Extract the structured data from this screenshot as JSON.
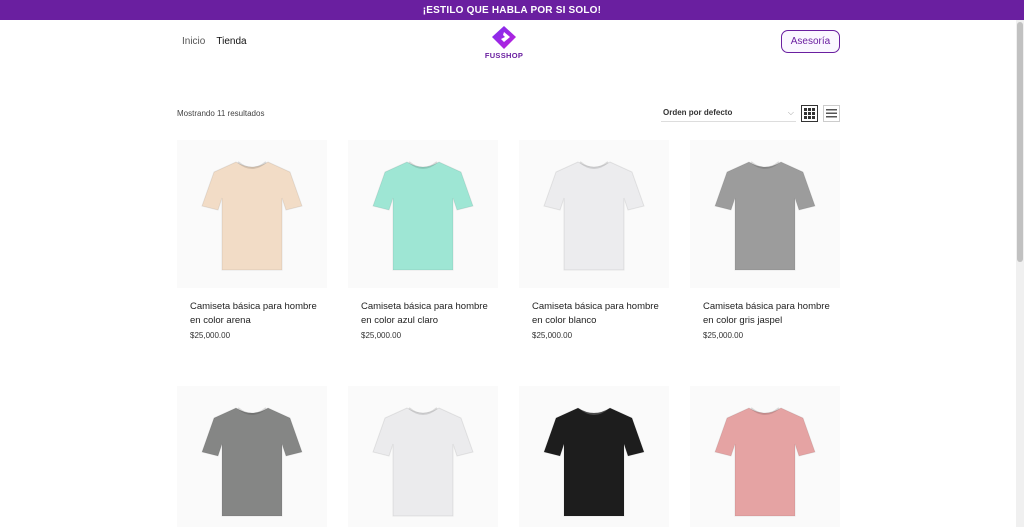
{
  "announcement": "¡ESTILO QUE HABLA POR SI SOLO!",
  "nav": {
    "inicio": "Inicio",
    "tienda": "Tienda"
  },
  "logo": {
    "text": "FUSSHOP"
  },
  "asesoria": "Asesoría",
  "shop": {
    "result_count": "Mostrando 11 resultados",
    "orderby": {
      "selected": "Orden por defecto"
    },
    "view_modes": [
      "grid",
      "list"
    ]
  },
  "colors": {
    "brand": "#6a1fa0"
  },
  "products": [
    {
      "title": "Camiseta básica para hombre en color arena",
      "price": "$25,000.00",
      "shirt_color": "#f2dcc6"
    },
    {
      "title": "Camiseta básica para hombre en color azul claro",
      "price": "$25,000.00",
      "shirt_color": "#9ee6d4"
    },
    {
      "title": "Camiseta básica para hombre en color blanco",
      "price": "$25,000.00",
      "shirt_color": "#ececee"
    },
    {
      "title": "Camiseta básica para hombre en color gris jaspel",
      "price": "$25,000.00",
      "shirt_color": "#9c9c9c"
    },
    {
      "title": "",
      "price": "",
      "shirt_color": "#858685"
    },
    {
      "title": "",
      "price": "",
      "shirt_color": "#ebebed"
    },
    {
      "title": "",
      "price": "",
      "shirt_color": "#1d1d1d"
    },
    {
      "title": "",
      "price": "",
      "shirt_color": "#e5a3a3"
    }
  ]
}
